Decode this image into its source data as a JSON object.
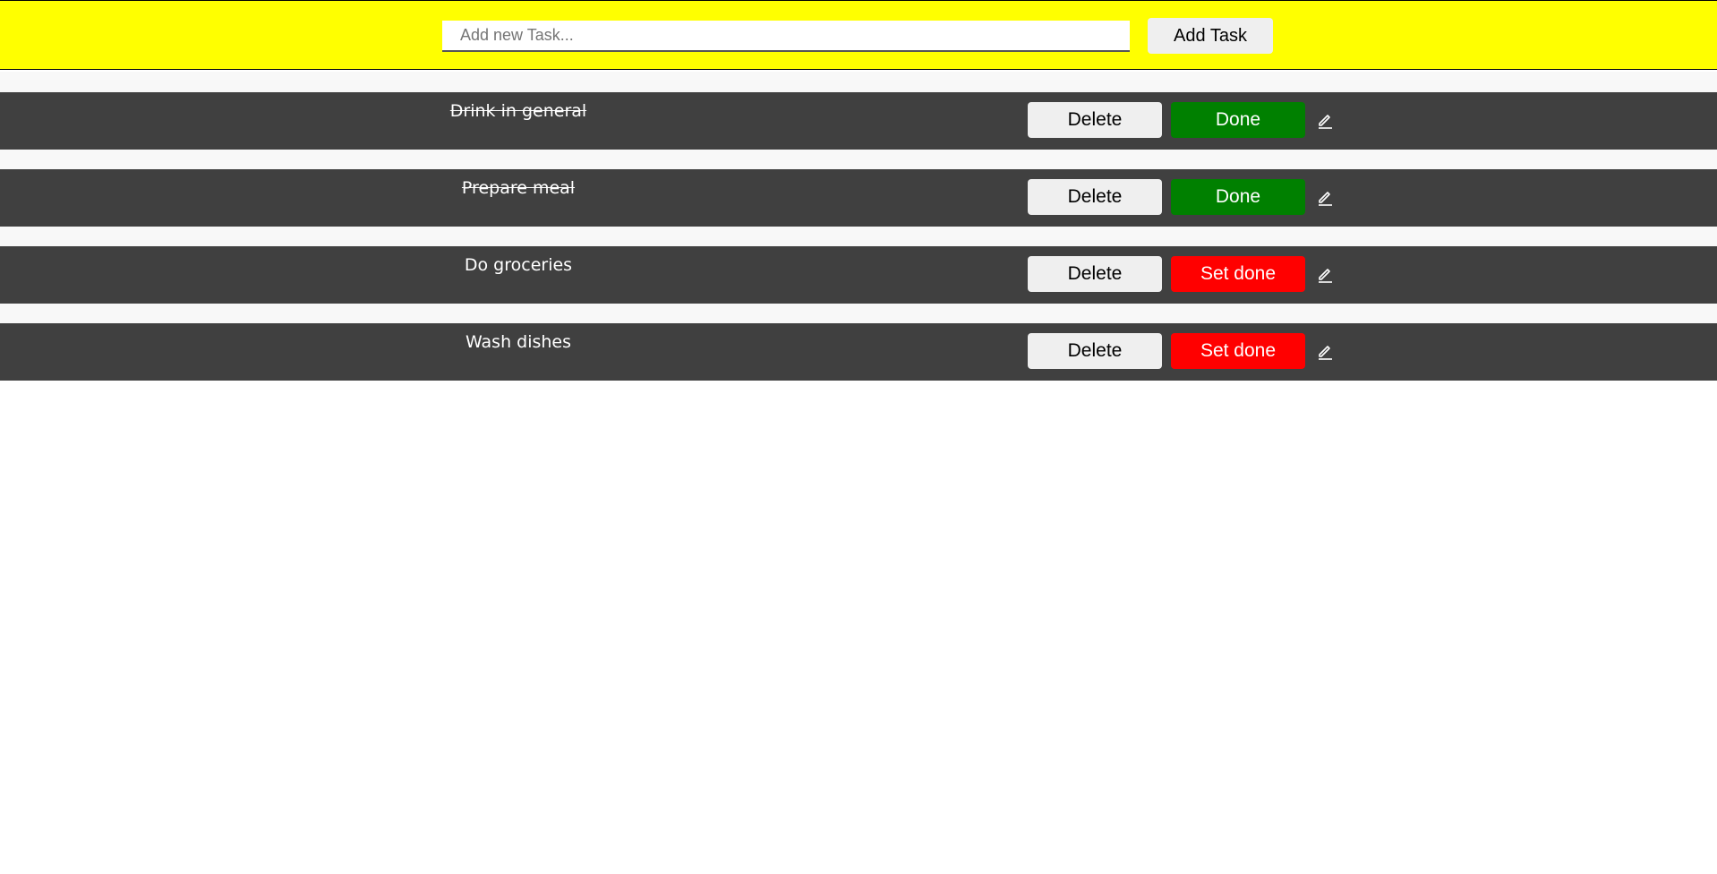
{
  "header": {
    "input_placeholder": "Add new Task...",
    "input_value": "",
    "add_button_label": "Add Task",
    "background_color": "#ffff00"
  },
  "tasks": [
    {
      "label": "Drink in general",
      "done": true,
      "delete_label": "Delete",
      "state_label": "Done",
      "state_color": "#008000",
      "edit_icon": "pencil-icon"
    },
    {
      "label": "Prepare meal",
      "done": true,
      "delete_label": "Delete",
      "state_label": "Done",
      "state_color": "#008000",
      "edit_icon": "pencil-icon"
    },
    {
      "label": "Do groceries",
      "done": false,
      "delete_label": "Delete",
      "state_label": "Set done",
      "state_color": "#ff0000",
      "edit_icon": "pencil-icon"
    },
    {
      "label": "Wash dishes",
      "done": false,
      "delete_label": "Delete",
      "state_label": "Set done",
      "state_color": "#ff0000",
      "edit_icon": "pencil-icon"
    }
  ],
  "colors": {
    "row_background": "#404040",
    "list_background": "#f8f8f8"
  }
}
